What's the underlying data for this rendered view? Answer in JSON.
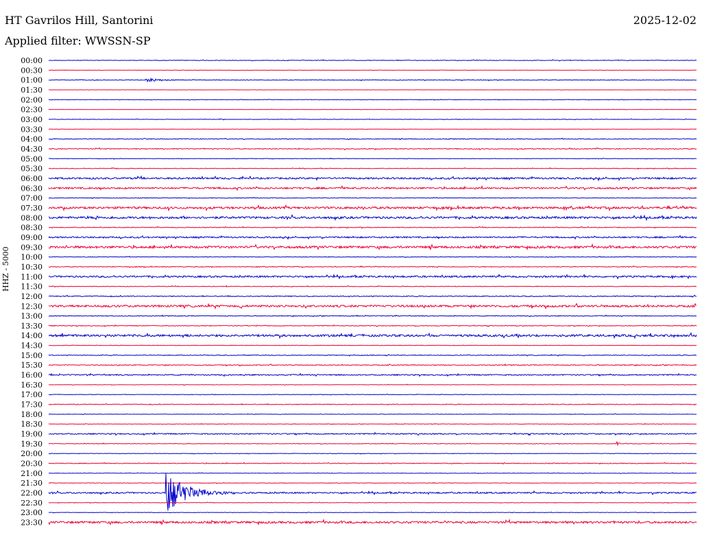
{
  "header": {
    "station": "HT Gavrilos Hill, Santorini",
    "date": "2025-12-02",
    "filter_label": "Applied filter: WWSSN-SP"
  },
  "channel_label": "HHZ - 5000",
  "chart_data": {
    "type": "line",
    "title": "HT Gavrilos Hill, Santorini",
    "date": "2025-12-02",
    "filter": "WWSSN-SP",
    "ylabel": "HHZ - 5000",
    "row_labels": [
      "00:00",
      "00:30",
      "01:00",
      "01:30",
      "02:00",
      "02:30",
      "03:00",
      "03:30",
      "04:00",
      "04:30",
      "05:00",
      "05:30",
      "06:00",
      "06:30",
      "07:00",
      "07:30",
      "08:00",
      "08:30",
      "09:00",
      "09:30",
      "10:00",
      "10:30",
      "11:00",
      "11:30",
      "12:00",
      "12:30",
      "13:00",
      "13:30",
      "14:00",
      "14:30",
      "15:00",
      "15:30",
      "16:00",
      "16:30",
      "17:00",
      "17:30",
      "18:00",
      "18:30",
      "19:00",
      "19:30",
      "20:00",
      "20:30",
      "21:00",
      "21:30",
      "22:00",
      "22:30",
      "23:00",
      "23:30"
    ],
    "row_minutes": 30,
    "trace_colors": [
      "#0000cc",
      "#ee0033"
    ],
    "noise_level": [
      0.4,
      0.2,
      0.4,
      0.2,
      0.3,
      0.2,
      0.3,
      0.2,
      0.5,
      0.6,
      0.3,
      0.4,
      1.2,
      1.2,
      0.4,
      1.5,
      1.5,
      0.5,
      1.0,
      1.6,
      0.4,
      0.5,
      1.2,
      0.4,
      0.6,
      1.5,
      0.5,
      0.5,
      1.5,
      0.3,
      0.5,
      0.6,
      0.8,
      0.3,
      0.3,
      0.5,
      0.3,
      0.3,
      0.8,
      0.4,
      0.3,
      0.5,
      0.3,
      0.3,
      1.0,
      0.3,
      0.3,
      1.5
    ],
    "events": [
      {
        "row": 2,
        "minute": 4.5,
        "amplitude": 3,
        "duration_min": 2.5
      },
      {
        "row": 4,
        "minute": 18.5,
        "amplitude": 2,
        "duration_min": 0.3
      },
      {
        "row": 6,
        "minute": 7.8,
        "amplitude": 1.5,
        "duration_min": 0.6
      },
      {
        "row": 8,
        "minute": 4.4,
        "amplitude": 1.5,
        "duration_min": 0.6
      },
      {
        "row": 11,
        "minute": 2.9,
        "amplitude": 2,
        "duration_min": 0.4
      },
      {
        "row": 14,
        "minute": 12,
        "amplitude": 2,
        "duration_min": 0.3
      },
      {
        "row": 17,
        "minute": 24.5,
        "amplitude": 2,
        "duration_min": 0.3
      },
      {
        "row": 23,
        "minute": 8.2,
        "amplitude": 2,
        "duration_min": 0.3
      },
      {
        "row": 27,
        "minute": 9.6,
        "amplitude": 2,
        "duration_min": 0.2
      },
      {
        "row": 39,
        "minute": 26.3,
        "amplitude": 4,
        "duration_min": 0.4
      },
      {
        "row": 44,
        "minute": 5.4,
        "amplitude": 34,
        "duration_min": 3.5
      }
    ]
  }
}
